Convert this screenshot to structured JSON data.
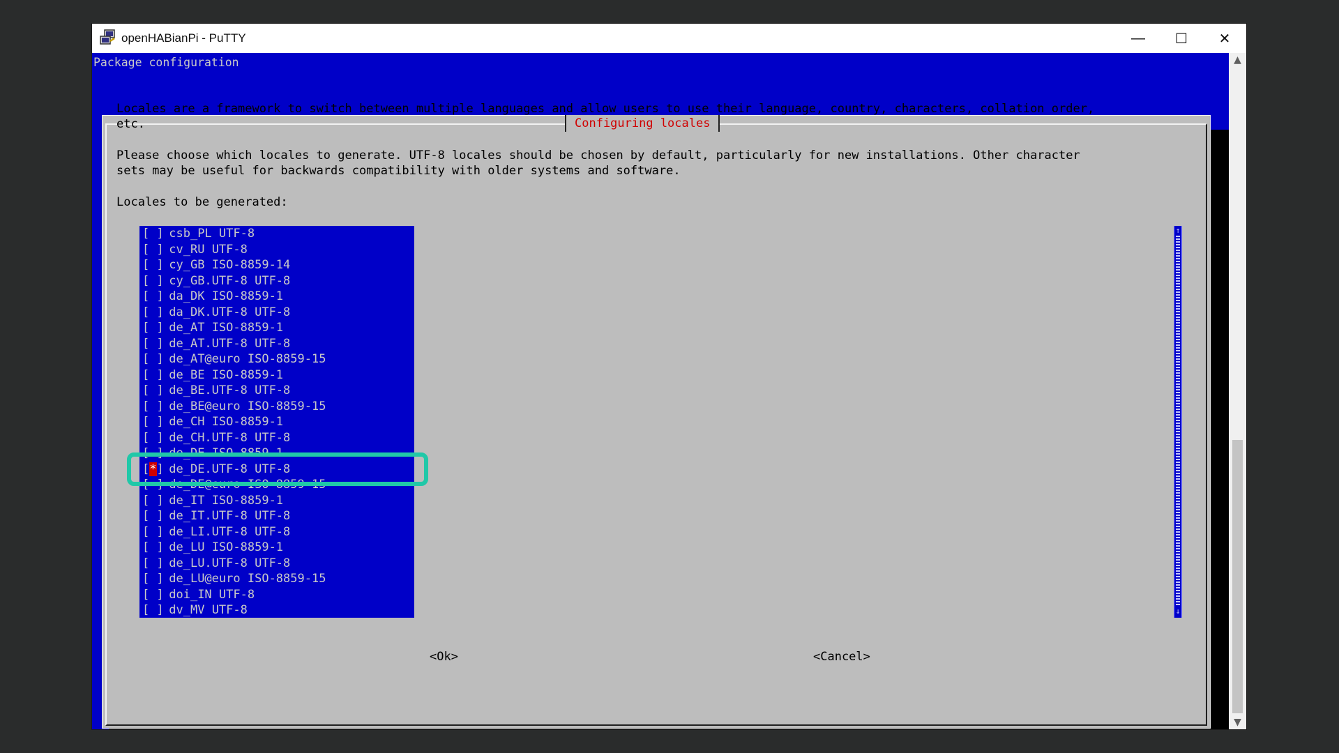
{
  "window": {
    "title": "openHABianPi - PuTTY",
    "minimize": "—",
    "maximize": "☐",
    "close": "✕"
  },
  "terminal": {
    "header": "Package configuration",
    "dialog_title": "Configuring locales",
    "para1_line1": "Locales are a framework to switch between multiple languages and allow users to use their language, country, characters, collation order,",
    "para1_line2": "etc.",
    "para2_line1": "Please choose which locales to generate. UTF-8 locales should be chosen by default, particularly for new installations. Other character",
    "para2_line2": "sets may be useful for backwards compatibility with older systems and software.",
    "prompt": "Locales to be generated:",
    "items": [
      {
        "checked": false,
        "locale": "csb_PL",
        "charset": "UTF-8"
      },
      {
        "checked": false,
        "locale": "cv_RU",
        "charset": "UTF-8"
      },
      {
        "checked": false,
        "locale": "cy_GB",
        "charset": "ISO-8859-14"
      },
      {
        "checked": false,
        "locale": "cy_GB.UTF-8",
        "charset": "UTF-8"
      },
      {
        "checked": false,
        "locale": "da_DK",
        "charset": "ISO-8859-1"
      },
      {
        "checked": false,
        "locale": "da_DK.UTF-8",
        "charset": "UTF-8"
      },
      {
        "checked": false,
        "locale": "de_AT",
        "charset": "ISO-8859-1"
      },
      {
        "checked": false,
        "locale": "de_AT.UTF-8",
        "charset": "UTF-8"
      },
      {
        "checked": false,
        "locale": "de_AT@euro",
        "charset": "ISO-8859-15"
      },
      {
        "checked": false,
        "locale": "de_BE",
        "charset": "ISO-8859-1"
      },
      {
        "checked": false,
        "locale": "de_BE.UTF-8",
        "charset": "UTF-8"
      },
      {
        "checked": false,
        "locale": "de_BE@euro",
        "charset": "ISO-8859-15"
      },
      {
        "checked": false,
        "locale": "de_CH",
        "charset": "ISO-8859-1"
      },
      {
        "checked": false,
        "locale": "de_CH.UTF-8",
        "charset": "UTF-8"
      },
      {
        "checked": false,
        "locale": "de_DE",
        "charset": "ISO-8859-1"
      },
      {
        "checked": true,
        "locale": "de_DE.UTF-8",
        "charset": "UTF-8"
      },
      {
        "checked": false,
        "locale": "de_DE@euro",
        "charset": "ISO-8859-15"
      },
      {
        "checked": false,
        "locale": "de_IT",
        "charset": "ISO-8859-1"
      },
      {
        "checked": false,
        "locale": "de_IT.UTF-8",
        "charset": "UTF-8"
      },
      {
        "checked": false,
        "locale": "de_LI.UTF-8",
        "charset": "UTF-8"
      },
      {
        "checked": false,
        "locale": "de_LU",
        "charset": "ISO-8859-1"
      },
      {
        "checked": false,
        "locale": "de_LU.UTF-8",
        "charset": "UTF-8"
      },
      {
        "checked": false,
        "locale": "de_LU@euro",
        "charset": "ISO-8859-15"
      },
      {
        "checked": false,
        "locale": "doi_IN",
        "charset": "UTF-8"
      },
      {
        "checked": false,
        "locale": "dv_MV",
        "charset": "UTF-8"
      }
    ],
    "ok_button": "<Ok>",
    "cancel_button": "<Cancel>"
  },
  "colors": {
    "terminal_bg": "#0000c8",
    "dialog_bg": "#bdbdbd",
    "title_red": "#d00000",
    "highlight": "#20c8a8"
  },
  "icons": {
    "app": "putty-icon"
  }
}
